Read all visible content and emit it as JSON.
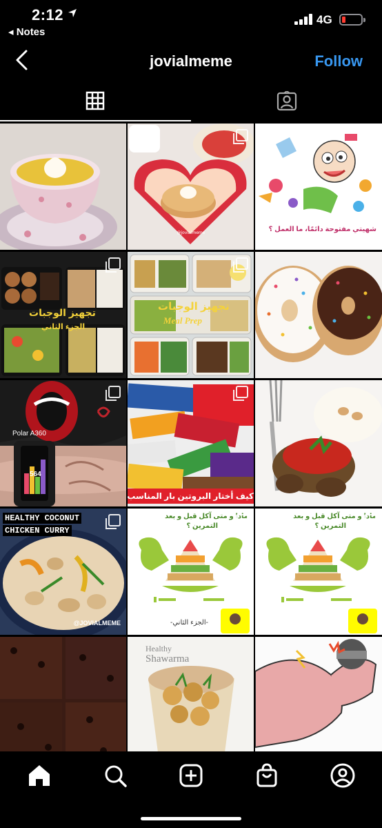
{
  "status_bar": {
    "time": "2:12",
    "back_app": "◂ Notes",
    "network": "4G",
    "battery_color": "#ff3b30"
  },
  "header": {
    "username": "jovialmeme",
    "follow_label": "Follow",
    "follow_color": "#3897f0"
  },
  "tabs": [
    {
      "name": "grid",
      "icon": "grid-icon",
      "active": true
    },
    {
      "name": "tagged",
      "icon": "tagged-person-icon",
      "active": false
    }
  ],
  "posts": [
    {
      "id": "custard-cup",
      "caption": ""
    },
    {
      "id": "pancakes-heart",
      "caption": ""
    },
    {
      "id": "cartoon-cravings",
      "caption": "شهيتي مفتوحة دائمًا، ما العمل ؟"
    },
    {
      "id": "meal-boxes",
      "caption": "تجهيز الوجبات",
      "caption2": "الجزء الثاني"
    },
    {
      "id": "meal-prep",
      "caption": "تجهيز الوجبات",
      "caption2": "Meal Prep"
    },
    {
      "id": "donuts",
      "caption": ""
    },
    {
      "id": "polar-watch",
      "caption": "Polar A360",
      "caption2": "564"
    },
    {
      "id": "protein-bars",
      "caption": "كيف أختار البروتين بار المناسب"
    },
    {
      "id": "kofta-rice",
      "caption": ""
    },
    {
      "id": "coconut-curry",
      "caption": "HEALTHY COCONUT",
      "caption2": "CHICKEN CURRY",
      "caption3": "@JOVIALMEME"
    },
    {
      "id": "pyramid-2",
      "caption": "ماذا و متى آكل قبل و بعد",
      "caption2": "التمرين ؟",
      "caption3": "-الجزء الثاني-"
    },
    {
      "id": "pyramid-1",
      "caption": "ماذا و متى آكل قبل و بعد",
      "caption2": "التمرين ؟"
    },
    {
      "id": "brownies",
      "caption": ""
    },
    {
      "id": "shawarma",
      "caption": "Healthy",
      "caption2": "Shawarma"
    },
    {
      "id": "muscle-arm",
      "caption": ""
    }
  ],
  "bottom_nav": [
    {
      "name": "home",
      "icon": "home-icon"
    },
    {
      "name": "search",
      "icon": "search-icon"
    },
    {
      "name": "new-post",
      "icon": "plus-square-icon"
    },
    {
      "name": "shop",
      "icon": "shopping-bag-icon"
    },
    {
      "name": "profile",
      "icon": "profile-icon"
    }
  ]
}
